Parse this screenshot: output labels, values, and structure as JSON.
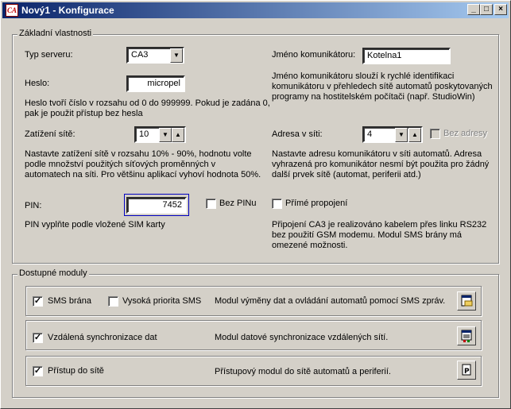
{
  "window": {
    "title": "Nový1 - Konfigurace",
    "icon_label": "CA",
    "buttons": {
      "minimize": "_",
      "maximize": "□",
      "close": "×"
    }
  },
  "basic": {
    "group_title": "Základní vlastnosti",
    "server_type": {
      "label": "Typ serveru:",
      "value": "CA3"
    },
    "communicator_name": {
      "label": "Jméno komunikátoru:",
      "value": "Kotelna1",
      "description": "Jméno komunikátoru slouží k rychlé identifikaci komunikátoru v přehledech sítě automatů poskytovaných programy na hostitelském počítači (např. StudioWin)"
    },
    "password": {
      "label": "Heslo:",
      "value": "micropel",
      "description": "Heslo tvoří číslo v rozsahu od 0 do 999999. Pokud je zadána 0, pak je použit přístup bez hesla"
    },
    "network_load": {
      "label": "Zatížení sítě:",
      "value": "10",
      "description": "Nastavte zatížení sítě v rozsahu 10% - 90%, hodnotu volte podle množství použitých síťových proměnných v automatech na síti. Pro většinu aplikací vyhoví hodnota 50%."
    },
    "network_address": {
      "label": "Adresa v síti:",
      "value": "4",
      "no_address_label": "Bez adresy",
      "description": "Nastavte adresu komunikátoru v síti automatů. Adresa vyhrazená pro komunikátor nesmí být použita pro žádný další prvek sítě (automat, periferii atd.)"
    },
    "pin": {
      "label": "PIN:",
      "value": "7452",
      "no_pin_label": "Bez PINu",
      "description": "PIN vyplňte podle vložené SIM karty"
    },
    "direct_connection": {
      "label": "Přímé propojení",
      "description": "Připojení CA3 je realizováno kabelem přes linku RS232 bez použití GSM modemu. Modul SMS brány má omezené možnosti."
    }
  },
  "modules": {
    "group_title": "Dostupné moduly",
    "items": [
      {
        "name": "SMS brána",
        "checked": true,
        "extra_label": "Vysoká priorita SMS",
        "extra_checked": false,
        "description": "Modul výměny dat a ovládání automatů pomocí SMS zpráv.",
        "icon": "sms-settings-icon"
      },
      {
        "name": "Vzdálená synchronizace dat",
        "checked": true,
        "description": "Modul datové synchronizace vzdálených sítí.",
        "icon": "sync-settings-icon"
      },
      {
        "name": "Přístup do sítě",
        "checked": true,
        "description": "Přístupový modul do sítě automatů a periferií.",
        "icon": "network-access-icon"
      }
    ]
  },
  "colors": {
    "title_start": "#0a246a",
    "title_end": "#a6caf0",
    "face": "#d4d0c8"
  }
}
